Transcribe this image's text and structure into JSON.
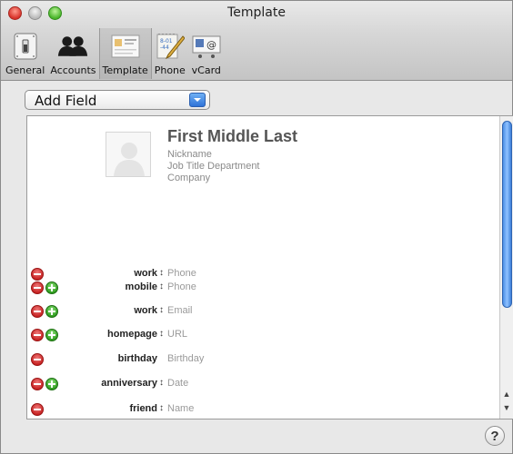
{
  "window": {
    "title": "Template"
  },
  "toolbar": {
    "items": [
      {
        "label": "General",
        "icon": "switch-icon"
      },
      {
        "label": "Accounts",
        "icon": "people-icon"
      },
      {
        "label": "Template",
        "icon": "card-icon",
        "selected": true
      },
      {
        "label": "Phone",
        "icon": "notepad-icon"
      },
      {
        "label": "vCard",
        "icon": "vcard-icon"
      }
    ]
  },
  "add_field": {
    "label": "Add Field"
  },
  "card": {
    "name": "First Middle Last",
    "nickname": "Nickname",
    "job": "Job Title Department",
    "company": "Company"
  },
  "fields": [
    {
      "label": "work",
      "has_arrows": true,
      "value": "Phone",
      "plus": false
    },
    {
      "label": "mobile",
      "has_arrows": true,
      "value": "Phone",
      "plus": true
    },
    {
      "label": "work",
      "has_arrows": true,
      "value": "Email",
      "plus": true
    },
    {
      "label": "homepage",
      "has_arrows": true,
      "value": "URL",
      "plus": true
    },
    {
      "label": "birthday",
      "has_arrows": false,
      "value": "Birthday",
      "plus": false
    },
    {
      "label": "anniversary",
      "has_arrows": true,
      "value": "Date",
      "plus": true
    },
    {
      "label": "friend",
      "has_arrows": true,
      "value": "Name",
      "plus": false
    }
  ],
  "help": {
    "label": "?"
  },
  "colors": {
    "accent": "#3d7fd8",
    "minus": "#c52020",
    "plus": "#2d9a1d"
  }
}
